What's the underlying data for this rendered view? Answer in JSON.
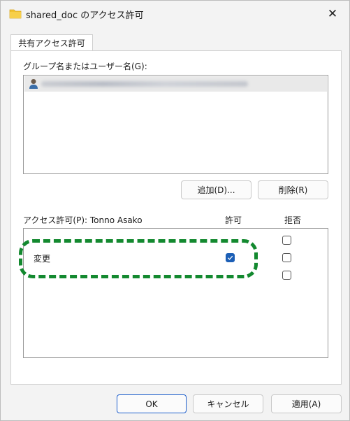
{
  "window": {
    "title": "shared_doc のアクセス許可",
    "close_symbol": "✕"
  },
  "tab": {
    "label": "共有アクセス許可"
  },
  "users_section": {
    "label": "グループ名またはユーザー名(G):",
    "items": [
      {
        "icon": "user-icon",
        "name": ""
      }
    ]
  },
  "buttons": {
    "add": "追加(D)...",
    "remove": "削除(R)",
    "ok": "OK",
    "cancel": "キャンセル",
    "apply": "適用(A)"
  },
  "permissions": {
    "label": "アクセス許可(P): Tonno Asako",
    "col_allow": "許可",
    "col_deny": "拒否",
    "rows": [
      {
        "name": "",
        "allow": false,
        "deny": false
      },
      {
        "name": "変更",
        "allow": true,
        "deny": false
      },
      {
        "name": "",
        "allow": false,
        "deny": false
      }
    ]
  },
  "colors": {
    "highlight": "#13892f",
    "checkbox_checked": "#1c5fb6",
    "folder": "#f2c230"
  }
}
